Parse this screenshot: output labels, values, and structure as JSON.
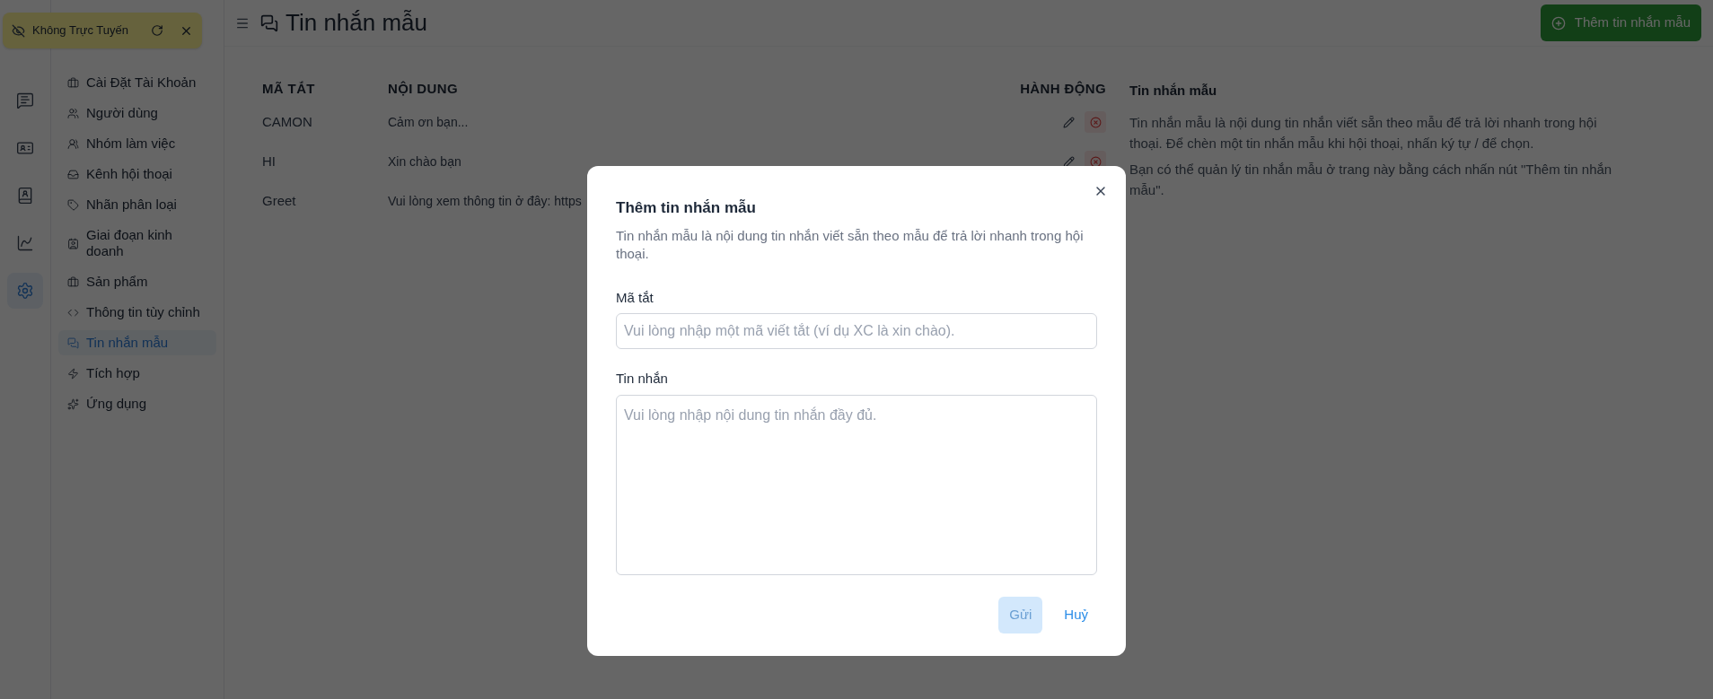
{
  "toast": {
    "text": "Không Trực Tuyến"
  },
  "rail": [
    {
      "selected": false
    },
    {
      "selected": false
    },
    {
      "selected": false
    },
    {
      "selected": false
    },
    {
      "selected": true
    }
  ],
  "sidebar": {
    "items": [
      {
        "label": "Cài Đặt Tài Khoản",
        "selected": false
      },
      {
        "label": "Người dùng",
        "selected": false
      },
      {
        "label": "Nhóm làm việc",
        "selected": false
      },
      {
        "label": "Kênh hội thoại",
        "selected": false
      },
      {
        "label": "Nhãn phân loại",
        "selected": false
      },
      {
        "label": "Giai đoạn kinh doanh",
        "selected": false
      },
      {
        "label": "Sản phẩm",
        "selected": false
      },
      {
        "label": "Thông tin tùy chỉnh",
        "selected": false
      },
      {
        "label": "Tin nhắn mẫu",
        "selected": true
      },
      {
        "label": "Tích hợp",
        "selected": false
      },
      {
        "label": "Ứng dụng",
        "selected": false
      }
    ]
  },
  "header": {
    "title": "Tin nhắn mẫu"
  },
  "add_button": {
    "label": "Thêm tin nhắn mẫu"
  },
  "table": {
    "columns": [
      "MÃ TẮT",
      "NỘI DUNG",
      "HÀNH ĐỘNG"
    ],
    "rows": [
      {
        "shortcut": "CAMON",
        "content": "Cảm ơn bạn...",
        "actions_visible": true
      },
      {
        "shortcut": "HI",
        "content": "Xin chào bạn",
        "actions_visible": true
      },
      {
        "shortcut": "Greet",
        "content": "Vui lòng xem thông tin ở đây: https",
        "actions_visible": false
      }
    ]
  },
  "help": {
    "title": "Tin nhắn mẫu",
    "paragraphs": [
      "Tin nhắn mẫu là nội dung tin nhắn viết sẵn theo mẫu để trả lời nhanh trong hội thoại. Để chèn một tin nhắn mẫu khi hội thoại, nhấn ký tự / để chọn.",
      "Bạn có thể quản lý tin nhắn mẫu ở trang này bằng cách nhấn nút \"Thêm tin nhắn mẫu\"."
    ]
  },
  "modal": {
    "title": "Thêm tin nhắn mẫu",
    "description": "Tin nhắn mẫu là nội dung tin nhắn viết sẵn theo mẫu để trả lời nhanh trong hội thoại.",
    "fields": [
      {
        "kind": "input",
        "label": "Mã tắt",
        "placeholder": "Vui lòng nhập một mã viết tắt (ví dụ XC là xin chào)."
      },
      {
        "kind": "textarea",
        "label": "Tin nhắn",
        "placeholder": "Vui lòng nhập nội dung tin nhắn đầy đủ."
      }
    ],
    "buttons": [
      {
        "kind": "primary",
        "label": "Gửi",
        "disabled": true
      },
      {
        "kind": "link",
        "label": "Huỷ",
        "disabled": false
      }
    ]
  }
}
